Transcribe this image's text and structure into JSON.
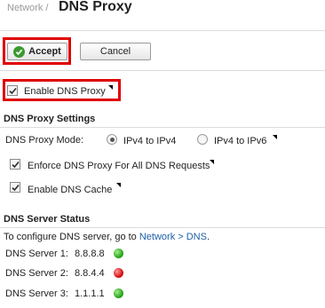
{
  "header": {
    "breadcrumb": "Network /",
    "title": "DNS Proxy"
  },
  "toolbar": {
    "accept_label": "Accept",
    "cancel_label": "Cancel"
  },
  "enable_dns_proxy": {
    "label": "Enable DNS Proxy",
    "checked": true
  },
  "settings": {
    "heading": "DNS Proxy Settings",
    "mode_label": "DNS Proxy Mode:",
    "mode_options": [
      "IPv4 to IPv4",
      "IPv4 to IPv6"
    ],
    "mode_selected": "IPv4 to IPv4",
    "enforce_label": "Enforce DNS Proxy For All DNS Requests",
    "enforce_checked": true,
    "cache_label": "Enable DNS Cache",
    "cache_checked": true
  },
  "status": {
    "heading": "DNS Server Status",
    "config_text": "To configure DNS server, go to",
    "config_link": "Network > DNS",
    "config_end": ".",
    "servers": [
      {
        "label": "DNS Server 1:",
        "ip": "8.8.8.8",
        "status": "green"
      },
      {
        "label": "DNS Server 2:",
        "ip": "8.8.4.4",
        "status": "red"
      },
      {
        "label": "DNS Server 3:",
        "ip": "1.1.1.1",
        "status": "green"
      }
    ]
  },
  "colors": {
    "highlight": "#e00000",
    "link": "#1f5fa8",
    "ok": "#2da81e",
    "error": "#d81515"
  }
}
